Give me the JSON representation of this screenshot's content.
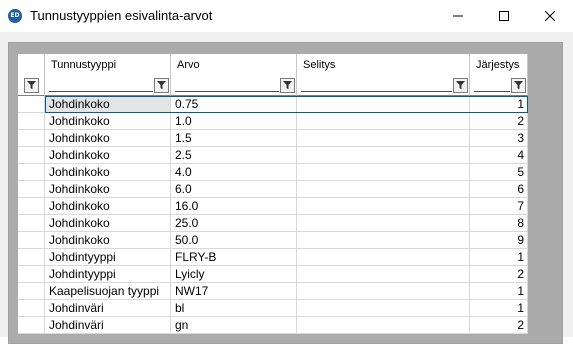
{
  "window": {
    "icon_text": "ED",
    "title": "Tunnustyyppien esivalinta-arvot"
  },
  "grid": {
    "columns": [
      {
        "label": "",
        "key": "selector"
      },
      {
        "label": "Tunnustyyppi",
        "key": "type"
      },
      {
        "label": "Arvo",
        "key": "value"
      },
      {
        "label": "Selitys",
        "key": "desc"
      },
      {
        "label": "Järjestys",
        "key": "order"
      }
    ],
    "selected_row": 0,
    "rows": [
      {
        "type": "Johdinkoko",
        "value": "0.75",
        "desc": "",
        "order": "1"
      },
      {
        "type": "Johdinkoko",
        "value": "1.0",
        "desc": "",
        "order": "2"
      },
      {
        "type": "Johdinkoko",
        "value": "1.5",
        "desc": "",
        "order": "3"
      },
      {
        "type": "Johdinkoko",
        "value": "2.5",
        "desc": "",
        "order": "4"
      },
      {
        "type": "Johdinkoko",
        "value": "4.0",
        "desc": "",
        "order": "5"
      },
      {
        "type": "Johdinkoko",
        "value": "6.0",
        "desc": "",
        "order": "6"
      },
      {
        "type": "Johdinkoko",
        "value": "16.0",
        "desc": "",
        "order": "7"
      },
      {
        "type": "Johdinkoko",
        "value": "25.0",
        "desc": "",
        "order": "8"
      },
      {
        "type": "Johdinkoko",
        "value": "50.0",
        "desc": "",
        "order": "9"
      },
      {
        "type": "Johdintyyppi",
        "value": "FLRY-B",
        "desc": "",
        "order": "1"
      },
      {
        "type": "Johdintyyppi",
        "value": "Lyicly",
        "desc": "",
        "order": "2"
      },
      {
        "type": "Kaapelisuojan tyyppi",
        "value": "NW17",
        "desc": "",
        "order": "1"
      },
      {
        "type": "Johdinväri",
        "value": "bl",
        "desc": "",
        "order": "1"
      },
      {
        "type": "Johdinväri",
        "value": "gn",
        "desc": "",
        "order": "2"
      }
    ]
  },
  "icons": {
    "filter": "filter-icon",
    "minimize": "minimize-icon",
    "maximize": "maximize-icon",
    "close": "close-icon"
  }
}
